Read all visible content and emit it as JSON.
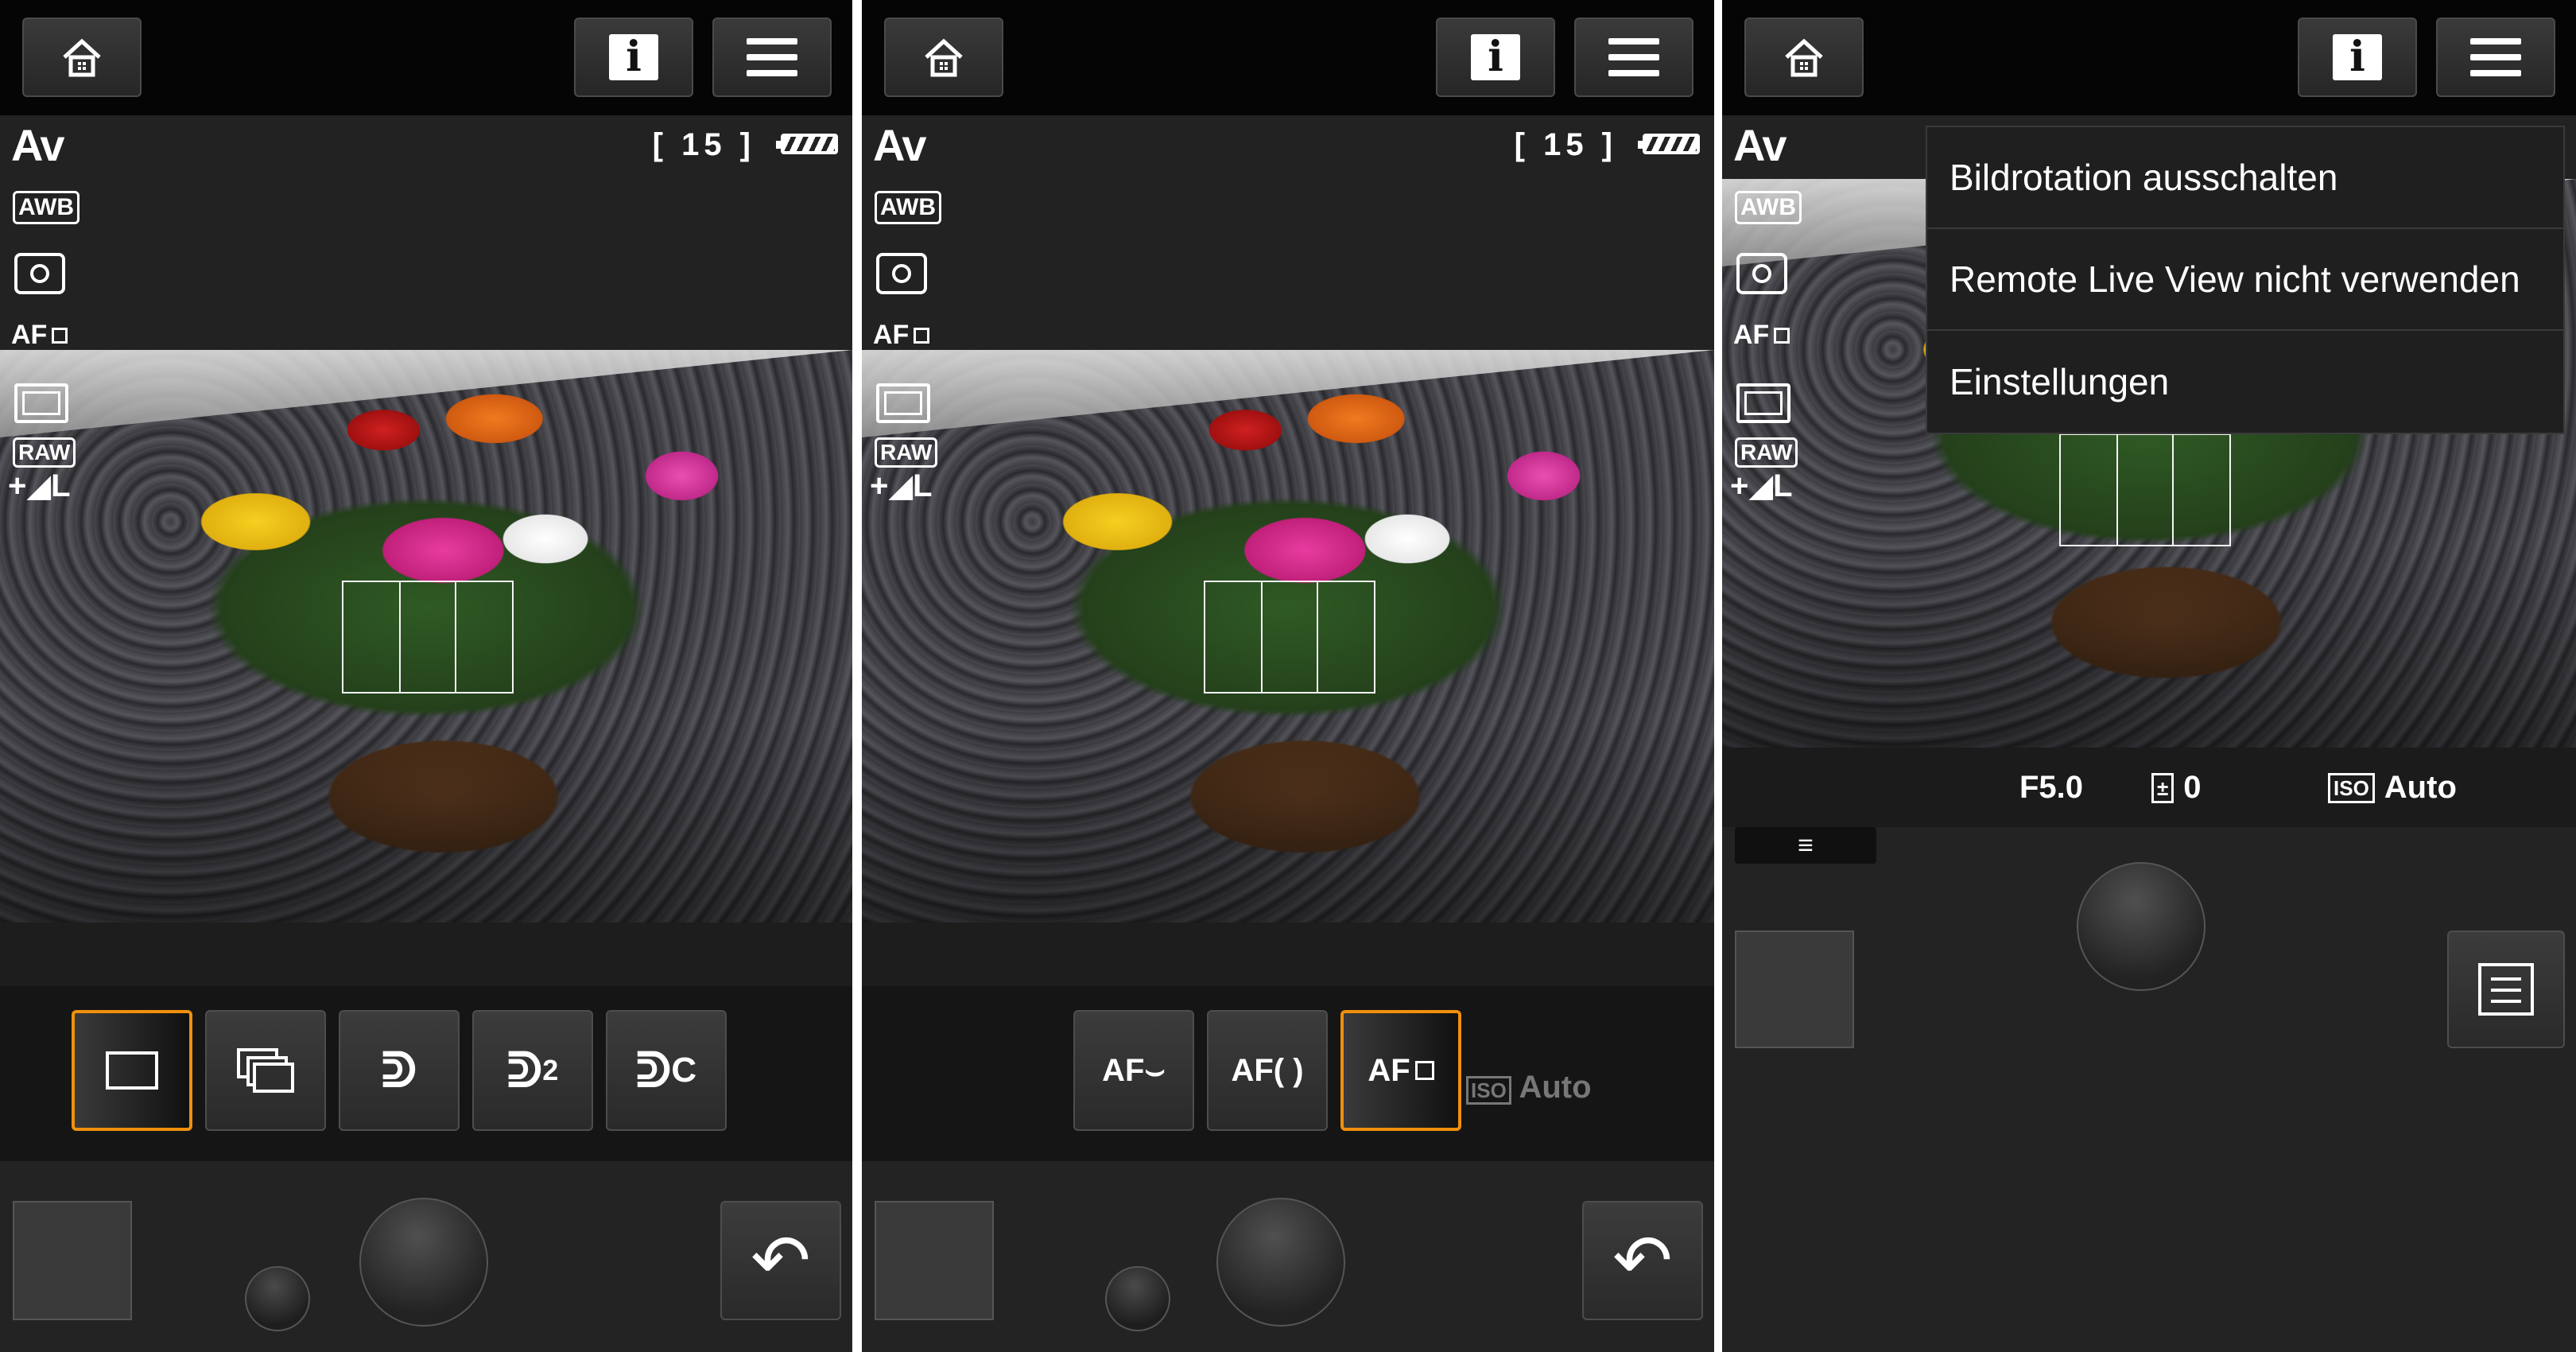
{
  "panels": [
    {
      "status": {
        "mode": "Av",
        "wb": "AWB",
        "af": "AF",
        "raw": "RAW",
        "quality": "+◢L",
        "shots": "[ 15 ]"
      },
      "options": [
        "single",
        "continuous",
        "timer-10",
        "timer-2",
        "timer-c"
      ],
      "options_labels": {
        "timer_2": "2",
        "timer_c": "C"
      }
    },
    {
      "status": {
        "mode": "Av",
        "wb": "AWB",
        "af": "AF",
        "raw": "RAW",
        "quality": "+◢L",
        "shots": "[ 15 ]"
      },
      "af_options": [
        "AF⌣",
        "AF( )",
        "AF"
      ],
      "ghost_iso": "Auto"
    },
    {
      "status": {
        "mode": "Av",
        "wb": "AWB",
        "af": "AF",
        "raw": "RAW",
        "quality": "+◢L"
      },
      "menu": [
        "Bildrotation ausschalten",
        "Remote Live View nicht verwenden",
        "Einstellungen"
      ],
      "exposure": {
        "aperture": "F5.0",
        "exp_comp": "0",
        "iso_label": "ISO",
        "iso_value": "Auto"
      }
    }
  ],
  "icons": {
    "home": "home-icon",
    "info": "i",
    "menu": "hamburger-icon",
    "back": "↶",
    "collapse": "≡"
  },
  "colors": {
    "selected_border": "#f0900c",
    "topbar": "#050505",
    "panel_bg": "#232323"
  }
}
